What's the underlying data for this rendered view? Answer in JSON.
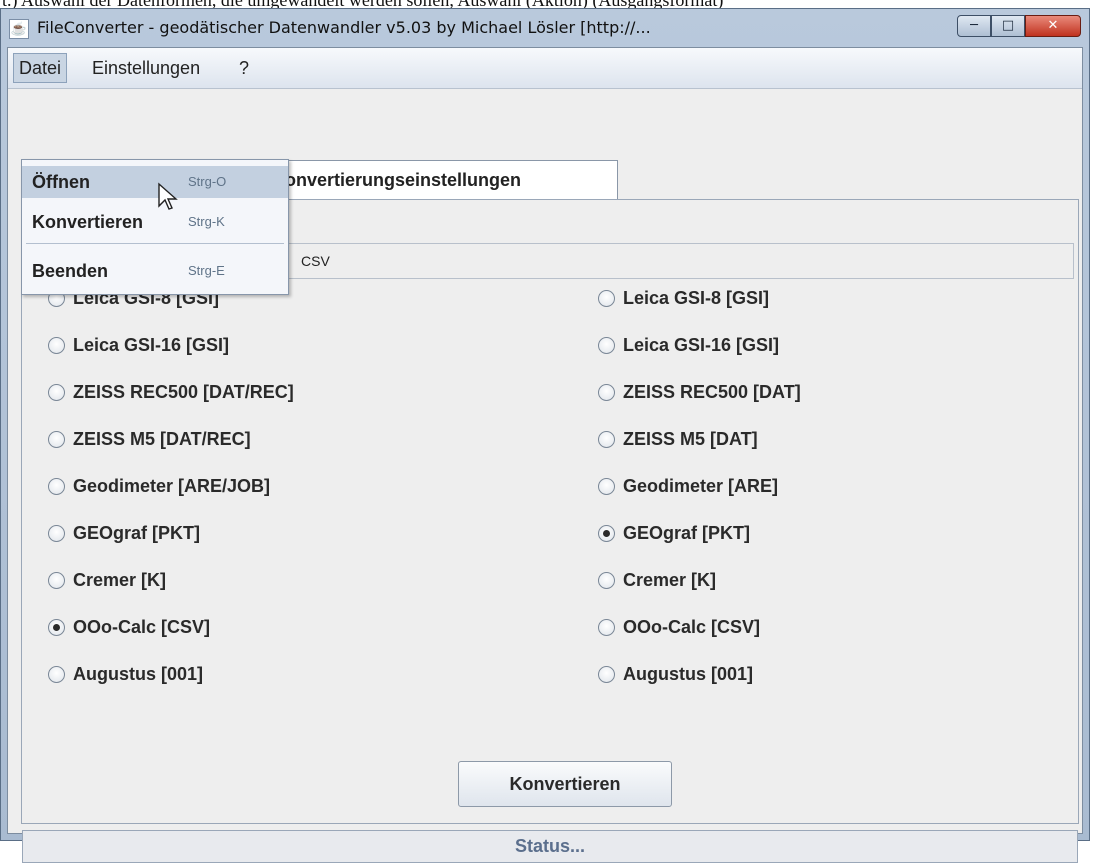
{
  "doc_strip_text": "t.) Auswahl der Datenformen, die umgewandelt werden sollen, Auswahl (Aktion) (Ausgangsformat)",
  "window": {
    "title": "FileConverter - geodätischer Datenwandler v5.03 by Michael Lösler [http://..."
  },
  "menu": {
    "datei": "Datei",
    "einstellungen": "Einstellungen",
    "help": "?"
  },
  "dropdown": {
    "items": [
      {
        "label": "Öffnen",
        "accel": "Strg-O"
      },
      {
        "label": "Konvertieren",
        "accel": "Strg-K"
      },
      {
        "label": "Beenden",
        "accel": "Strg-E"
      }
    ]
  },
  "tab_label": "Konvertierungseinstellungen",
  "tab_visible_label": "onvertierungseinstellungen",
  "path_field_text": "CSV",
  "source_formats": [
    {
      "label": "Leica GSI-8 [GSI]",
      "selected": false
    },
    {
      "label": "Leica GSI-16 [GSI]",
      "selected": false
    },
    {
      "label": "ZEISS REC500 [DAT/REC]",
      "selected": false
    },
    {
      "label": "ZEISS M5 [DAT/REC]",
      "selected": false
    },
    {
      "label": "Geodimeter [ARE/JOB]",
      "selected": false
    },
    {
      "label": "GEOgraf [PKT]",
      "selected": false
    },
    {
      "label": "Cremer [K]",
      "selected": false
    },
    {
      "label": "OOo-Calc [CSV]",
      "selected": true
    },
    {
      "label": "Augustus [001]",
      "selected": false
    }
  ],
  "target_formats": [
    {
      "label": "Leica GSI-8 [GSI]",
      "selected": false
    },
    {
      "label": "Leica GSI-16 [GSI]",
      "selected": false
    },
    {
      "label": "ZEISS REC500 [DAT]",
      "selected": false
    },
    {
      "label": "ZEISS M5 [DAT]",
      "selected": false
    },
    {
      "label": "Geodimeter [ARE]",
      "selected": false
    },
    {
      "label": "GEOgraf [PKT]",
      "selected": true
    },
    {
      "label": "Cremer [K]",
      "selected": false
    },
    {
      "label": "OOo-Calc [CSV]",
      "selected": false
    },
    {
      "label": "Augustus [001]",
      "selected": false
    }
  ],
  "convert_button": "Konvertieren",
  "status_text": "Status...",
  "icons": {
    "app": "java-cup-icon",
    "cursor": "mouse-pointer-icon"
  }
}
